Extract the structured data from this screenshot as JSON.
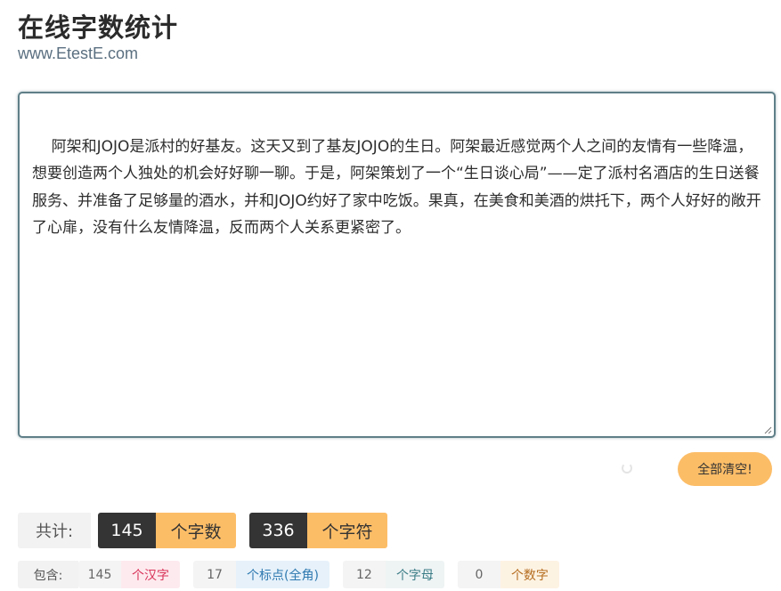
{
  "header": {
    "title": "在线字数统计",
    "subtitle": "www.EtestE.com"
  },
  "editor": {
    "text": "阿架和JOJO是派村的好基友。这天又到了基友JOJO的生日。阿架最近感觉两个人之间的友情有一些降温，想要创造两个人独处的机会好好聊一聊。于是，阿架策划了一个“生日谈心局”——定了派村名酒店的生日送餐服务、并准备了足够量的酒水，并和JOJO约好了家中吃饭。果真，在美食和美酒的烘托下，两个人好好的敞开了心扉，没有什么友情降温，反而两个人关系更紧密了。"
  },
  "actions": {
    "clear_label": "全部清空!"
  },
  "totals": {
    "label": "共计:",
    "char_count": "145",
    "char_unit": "个字数",
    "symbol_count": "336",
    "symbol_unit": "个字符"
  },
  "details": {
    "label": "包含:",
    "items": [
      {
        "count": "145",
        "unit": "个汉字"
      },
      {
        "count": "17",
        "unit": "个标点(全角)"
      },
      {
        "count": "12",
        "unit": "个字母"
      },
      {
        "count": "0",
        "unit": "个数字"
      }
    ]
  },
  "colors": {
    "accent": "#fcbd67",
    "dark": "#343434",
    "editor_border": "#5f7f88"
  }
}
